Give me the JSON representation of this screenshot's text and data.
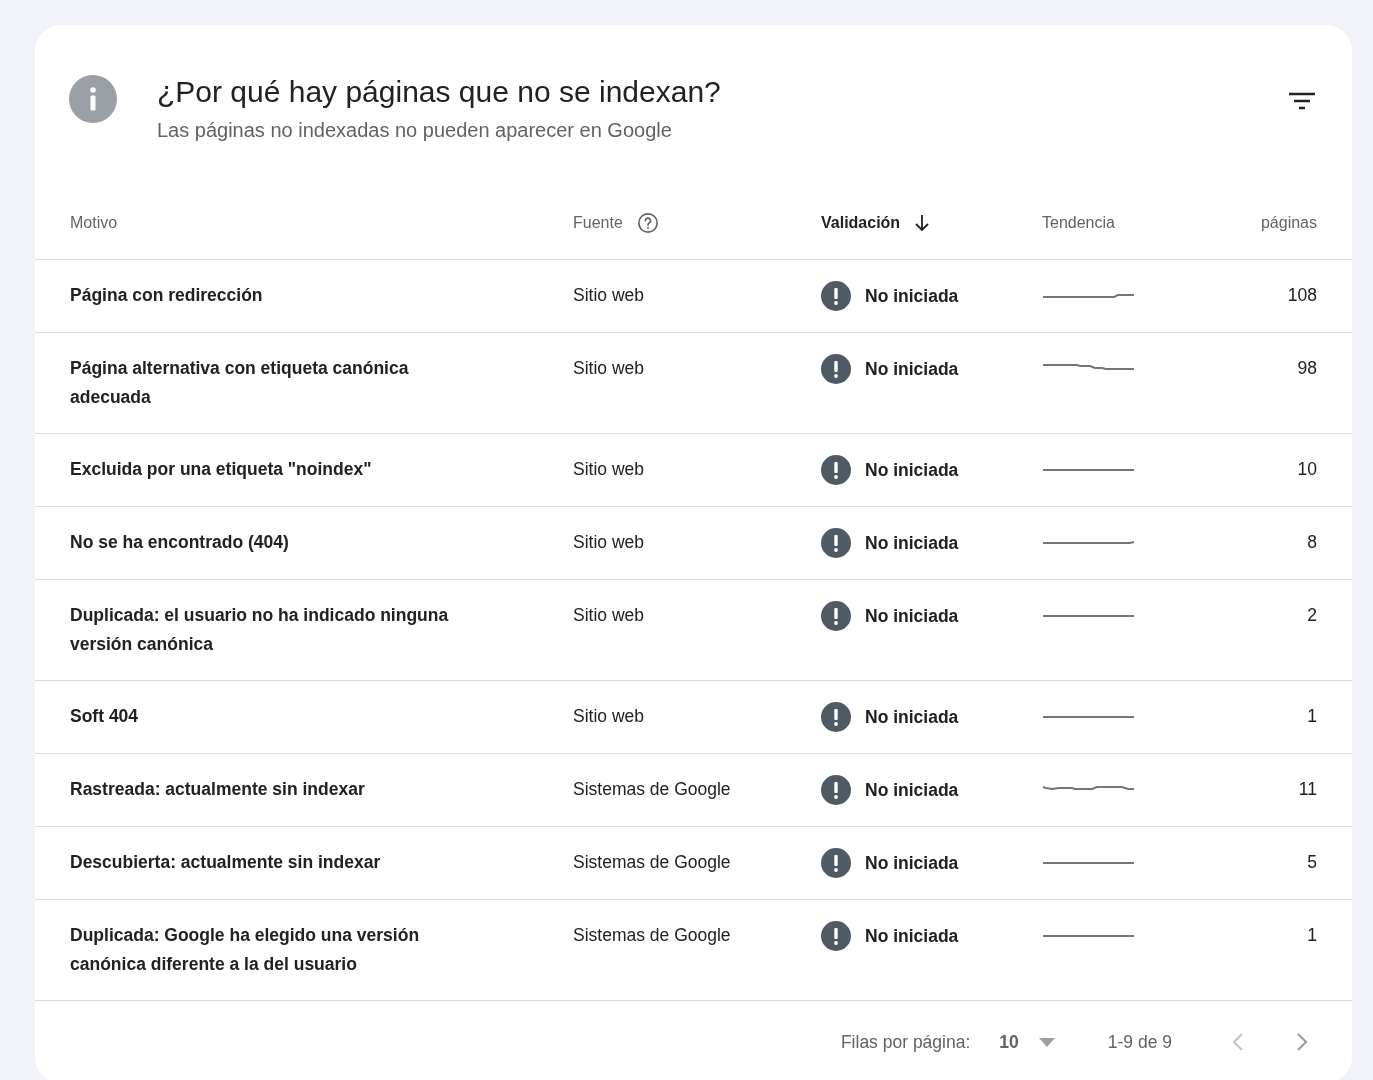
{
  "header": {
    "title": "¿Por qué hay páginas que no se indexan?",
    "subtitle": "Las páginas no indexadas no pueden aparecer en Google"
  },
  "table": {
    "columns": [
      {
        "label": "Motivo",
        "kind": "plain",
        "sorted": false
      },
      {
        "label": "Fuente",
        "kind": "help",
        "sorted": false
      },
      {
        "label": "Validación",
        "kind": "plain",
        "sorted": true
      },
      {
        "label": "Tendencia",
        "kind": "plain",
        "sorted": false
      },
      {
        "label": "páginas",
        "kind": "plain",
        "sorted": false
      }
    ],
    "rows": [
      {
        "reason": "Página con redirección",
        "source": "Sitio web",
        "validation": "No iniciada",
        "pages": "108"
      },
      {
        "reason": "Página alternativa con etiqueta canónica adecuada",
        "source": "Sitio web",
        "validation": "No iniciada",
        "pages": "98"
      },
      {
        "reason": "Excluida por una etiqueta \"noindex\"",
        "source": "Sitio web",
        "validation": "No iniciada",
        "pages": "10"
      },
      {
        "reason": "No se ha encontrado (404)",
        "source": "Sitio web",
        "validation": "No iniciada",
        "pages": "8"
      },
      {
        "reason": "Duplicada: el usuario no ha indicado ninguna versión canónica",
        "source": "Sitio web",
        "validation": "No iniciada",
        "pages": "2"
      },
      {
        "reason": "Soft 404",
        "source": "Sitio web",
        "validation": "No iniciada",
        "pages": "1"
      },
      {
        "reason": "Rastreada: actualmente sin indexar",
        "source": "Sistemas de Google",
        "validation": "No iniciada",
        "pages": "11"
      },
      {
        "reason": "Descubierta: actualmente sin indexar",
        "source": "Sistemas de Google",
        "validation": "No iniciada",
        "pages": "5"
      },
      {
        "reason": "Duplicada: Google ha elegido una versión canónica diferente a la del usuario",
        "source": "Sistemas de Google",
        "validation": "No iniciada",
        "pages": "1"
      }
    ]
  },
  "pagination": {
    "rows_label": "Filas por página:",
    "rows_value": "10",
    "range": "1-9 de 9",
    "prev_disabled": true,
    "next_disabled": false
  }
}
